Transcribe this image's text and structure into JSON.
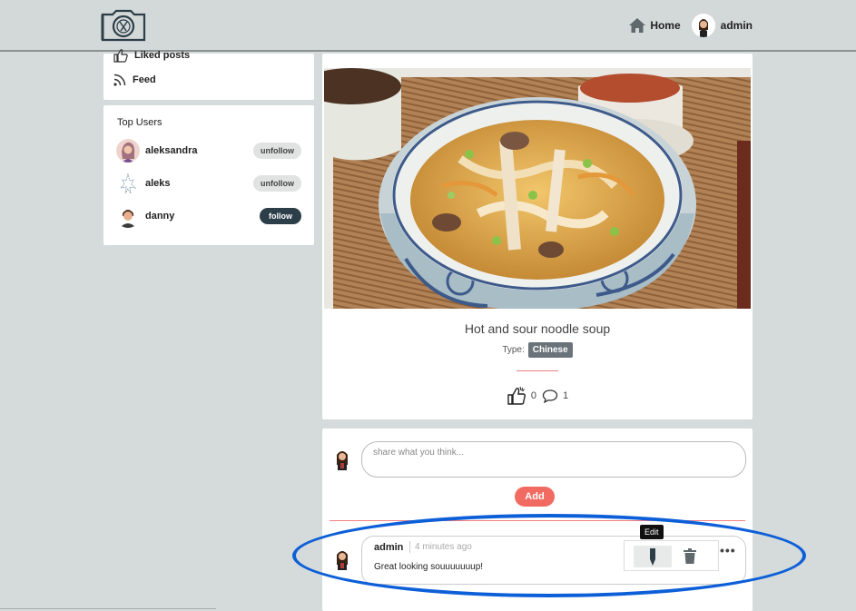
{
  "header": {
    "home_label": "Home",
    "user_label": "admin"
  },
  "sidebar": {
    "menu": [
      {
        "label": "Liked posts",
        "icon": "thumbs-up-icon"
      },
      {
        "label": "Feed",
        "icon": "rss-icon"
      }
    ],
    "top_users": {
      "title": "Top Users",
      "users": [
        {
          "name": "aleksandra",
          "action": "unfollow"
        },
        {
          "name": "aleks",
          "action": "unfollow"
        },
        {
          "name": "danny",
          "action": "follow"
        }
      ]
    }
  },
  "post": {
    "title": "Hot and sour noodle soup",
    "type_label": "Type:",
    "type_value": "Chinese",
    "likes": "0",
    "comments": "1"
  },
  "comments": {
    "input_placeholder": "share what you think...",
    "add_label": "Add",
    "items": [
      {
        "author": "admin",
        "time": "4 minutes ago",
        "text": "Great looking souuuuuuup!"
      }
    ],
    "tooltip": "Edit",
    "more": "•••"
  },
  "colors": {
    "header_bg": "#d3d8d8",
    "page_bg": "#d5dbdb",
    "accent": "#f26b62",
    "follow_btn": "#2c3e48",
    "badge": "#6b737a",
    "annotation": "#0d5fd8"
  }
}
